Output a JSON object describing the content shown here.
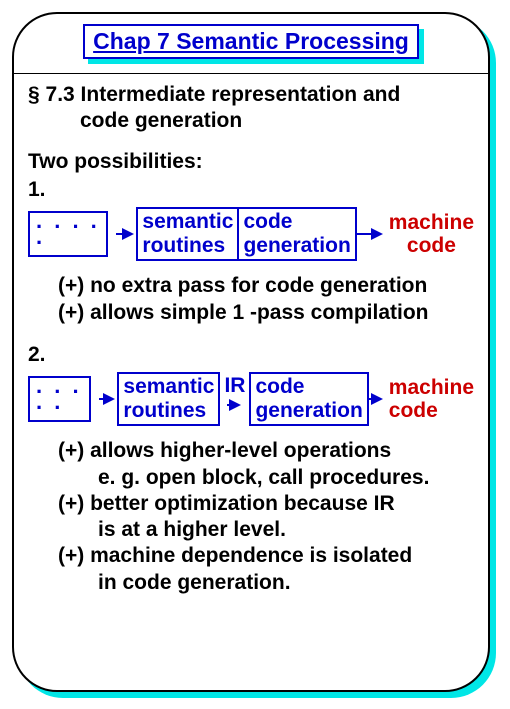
{
  "title": "Chap 7  Semantic Processing",
  "section": {
    "heading_line1": "§ 7.3 Intermediate representation and",
    "heading_line2": "code generation"
  },
  "intro": "Two possibilities:",
  "item1": {
    "num": "1.",
    "ellipsis": ". . . . .",
    "box1": "semantic\nroutines",
    "box2": "code\ngeneration",
    "out": "machine\ncode",
    "plus1": "(+) no extra pass for code generation",
    "plus2": "(+) allows simple 1 -pass compilation"
  },
  "item2": {
    "num": "2.",
    "ellipsis": ". . . . .",
    "box1": "semantic\nroutines",
    "ir": "IR",
    "box2": "code\ngeneration",
    "out": "machine\ncode",
    "plus1": "(+) allows higher-level operations",
    "plus1b": "e. g. open block, call procedures.",
    "plus2": "(+) better optimization because IR",
    "plus2b": "is at a higher level.",
    "plus3": "(+) machine dependence is isolated",
    "plus3b": "in code generation."
  }
}
